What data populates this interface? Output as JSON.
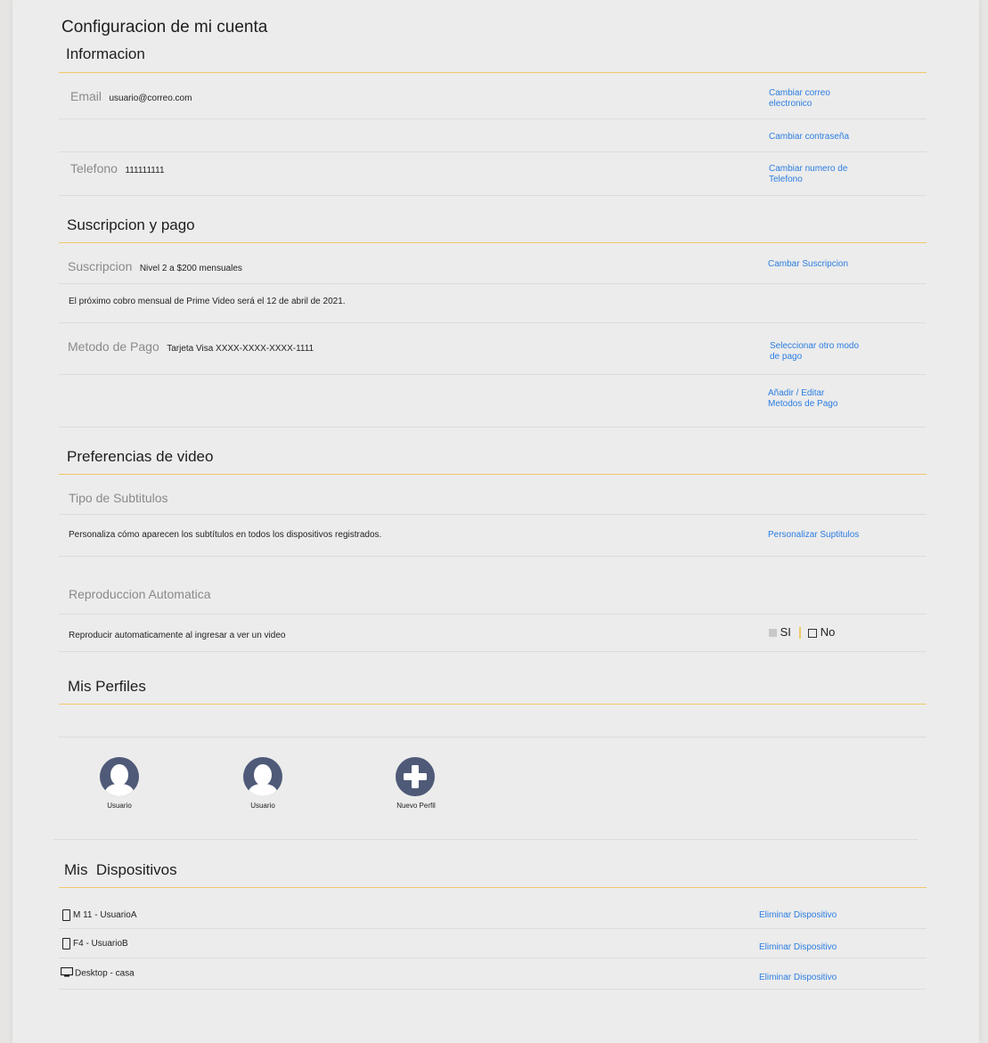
{
  "page": {
    "title": "Configuracion de mi cuenta"
  },
  "informacion": {
    "title": "Informacion",
    "email_label": "Email",
    "email_value": "usuario@correo.com",
    "change_email_line1": "Cambiar correo",
    "change_email_line2": "electronico",
    "change_password": "Cambiar contraseña",
    "phone_label": "Telefono",
    "phone_value": "111111111",
    "change_phone_line1": "Cambiar numero de",
    "change_phone_line2": "Telefono"
  },
  "suscripcion": {
    "title": "Suscripcion y pago",
    "sub_label": "Suscripcion",
    "sub_value": "Nivel 2 a $200 mensuales",
    "change_sub": "Cambar Suscripcion",
    "next_charge": "El próximo cobro mensual de Prime Video será el 12 de abril de 2021.",
    "payment_label": "Metodo de Pago",
    "payment_value": "Tarjeta Visa XXXX-XXXX-XXXX-1111",
    "select_payment_line1": "Seleccionar otro modo",
    "select_payment_line2": "de pago",
    "edit_payment_line1": "Añadir / Editar",
    "edit_payment_line2": "Metodos de Pago"
  },
  "video": {
    "title": "Preferencias de video",
    "subtitles_label": "Tipo de Subtitulos",
    "subtitles_desc": "Personaliza cómo aparecen los subtítulos en todos los dispositivos registrados.",
    "subtitles_link": "Personalizar Suptitulos",
    "autoplay_label": "Reproduccion Automatica",
    "autoplay_desc": "Reproducir automaticamente al ingresar a ver un video",
    "opt_yes": "SI",
    "opt_no": "No",
    "selected": "SI"
  },
  "perfiles": {
    "title": "Mis Perfiles",
    "items": [
      {
        "label": "Usuario"
      },
      {
        "label": "Usuario"
      },
      {
        "label": "Nuevo Perfil"
      }
    ]
  },
  "dispositivos": {
    "title": "Mis  Dispositivos",
    "items": [
      {
        "name": "M 11 - UsuarioA",
        "icon": "phone-icon",
        "action": "Eliminar Dispositivo"
      },
      {
        "name": "F4 - UsuarioB",
        "icon": "phone-icon",
        "action": "Eliminar Dispositivo"
      },
      {
        "name": "Desktop - casa",
        "icon": "desktop-icon",
        "action": "Eliminar Dispositivo"
      }
    ]
  },
  "colors": {
    "accent_rule": "#f0c868",
    "link": "#2b7de0",
    "avatar": "#4e5a77"
  }
}
